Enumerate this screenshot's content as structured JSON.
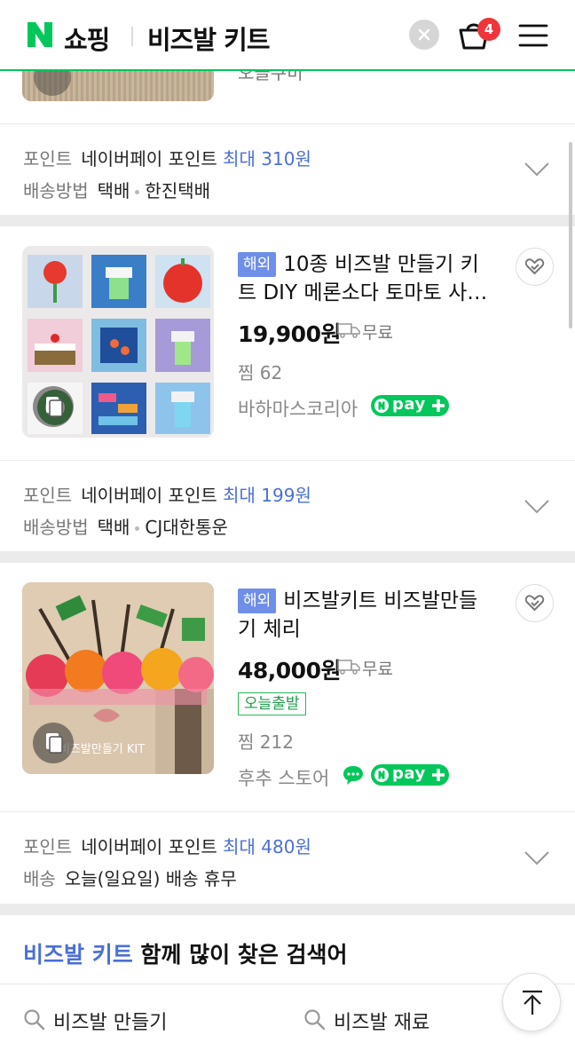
{
  "header": {
    "logo_letter": "N",
    "logo_text": "쇼핑",
    "query": "비즈발 키트",
    "cart_count": "4",
    "brand_color": "#03c75a"
  },
  "partial_item": {
    "store_fragment": "오늘쿠미"
  },
  "info_blocks": [
    {
      "point_label": "포인트",
      "point_type": "네이버페이 포인트",
      "point_amount": "최대 310원",
      "ship_label": "배송방법",
      "ship_method": "택배",
      "ship_carrier": "한진택배"
    },
    {
      "point_label": "포인트",
      "point_type": "네이버페이 포인트",
      "point_amount": "최대 199원",
      "ship_label": "배송방법",
      "ship_method": "택배",
      "ship_carrier": "CJ대한통운"
    },
    {
      "point_label": "포인트",
      "point_type": "네이버페이 포인트",
      "point_amount": "최대 480원",
      "ship_label": "배송",
      "ship_method": "오늘(일요일) 배송 휴무"
    }
  ],
  "products": [
    {
      "badge": "해외",
      "title_line1": "10종 비즈발 만들기 키",
      "title_line2": "트 DIY 메론소다 토마토 사…",
      "price": "19,900원",
      "shipping": "무료",
      "jjim": "찜 62",
      "store": "바하마스코리아",
      "npay": "pay"
    },
    {
      "badge": "해외",
      "title_line1": "비즈발키트 비즈발만들",
      "title_line2": "기 체리",
      "price": "48,000원",
      "shipping": "무료",
      "today_badge": "오늘출발",
      "jjim": "찜 212",
      "store": "후추 스토어",
      "npay": "pay",
      "thumb_caption": "비즈발만들기 KIT"
    }
  ],
  "related": {
    "keyword": "비즈발 키트",
    "title_rest": " 함께 많이 찾은 검색어",
    "items": [
      "비즈발 만들기",
      "비즈발 재료"
    ]
  }
}
